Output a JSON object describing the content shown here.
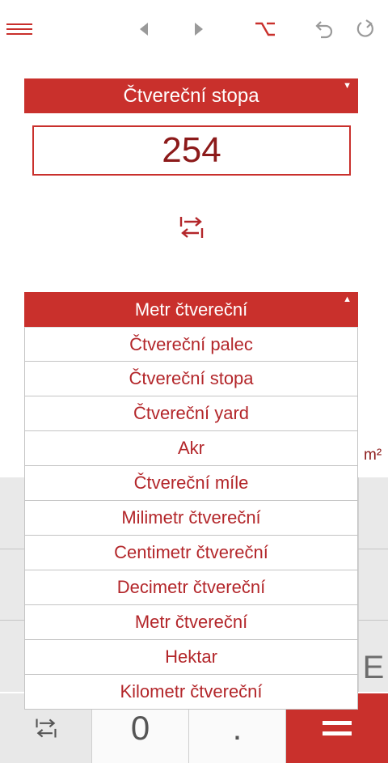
{
  "toolbar": {
    "icons": [
      "menu-icon",
      "arrow-left-icon",
      "arrow-right-icon",
      "option-key-icon",
      "undo-icon",
      "redo-icon"
    ]
  },
  "converter": {
    "from_unit": "Čtvereční stopa",
    "input_value": "254",
    "to_unit": "Metr čtvereční",
    "result_unit_symbol": "m²"
  },
  "dropdown": {
    "options": [
      "Čtvereční palec",
      "Čtvereční stopa",
      "Čtvereční yard",
      "Akr",
      "Čtvereční míle",
      "Milimetr čtvereční",
      "Centimetr čtvereční",
      "Decimetr čtvereční",
      "Metr čtvereční",
      "Hektar",
      "Kilometr čtvereční"
    ]
  },
  "keypad": {
    "zero": "0",
    "dot": ".",
    "ghost_key": "E"
  },
  "colors": {
    "accent": "#c9302c",
    "text_dark_red": "#8c1a1a",
    "item_text": "#b3262a"
  }
}
